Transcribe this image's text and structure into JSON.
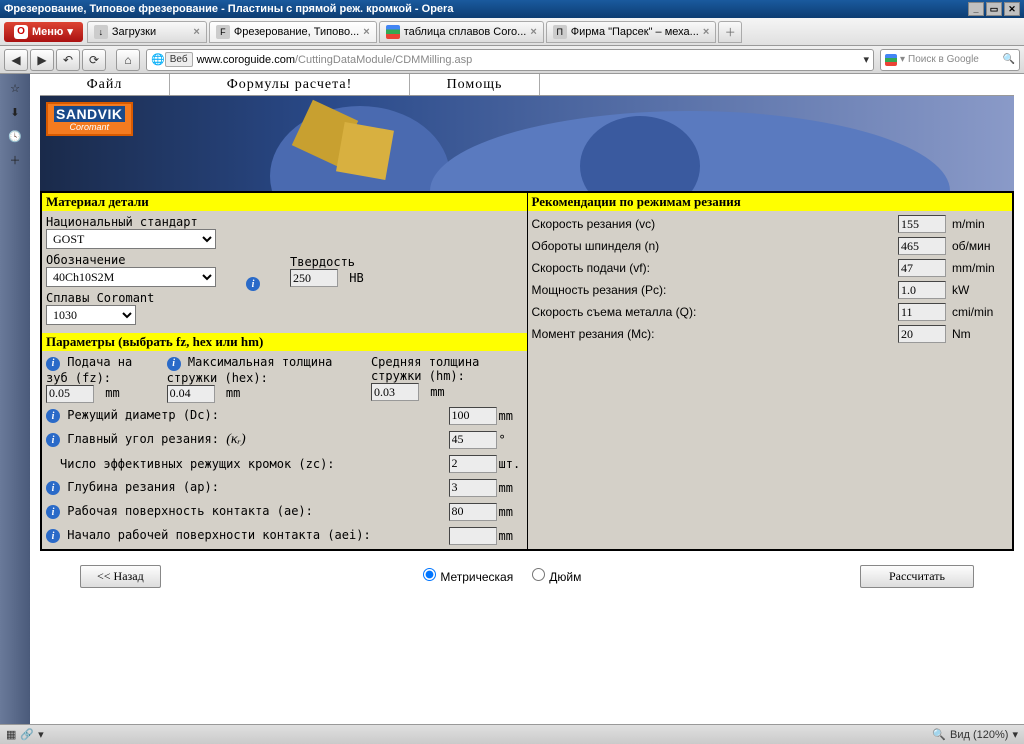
{
  "window": {
    "title": "Фрезерование, Типовое фрезерование - Пластины с прямой реж. кромкой - Opera"
  },
  "opera": {
    "menu": "Меню"
  },
  "tabs": [
    {
      "label": "Загрузки",
      "fav": "↓"
    },
    {
      "label": "Фрезерование, Типово...",
      "fav": "F"
    },
    {
      "label": "таблица сплавов Coro...",
      "fav": "G"
    },
    {
      "label": "Фирма \"Парсек\" – меха...",
      "fav": "П"
    }
  ],
  "url": {
    "web": "Веб",
    "host": "www.coroguide.com",
    "path": "/CuttingDataModule/CDMMilling.asp"
  },
  "search": {
    "placeholder": "Поиск в Google"
  },
  "appmenu": {
    "file": "Файл",
    "formulas": "Формулы расчета!",
    "help": "Помощь"
  },
  "logo": {
    "t1": "SANDVIK",
    "t2": "Coromant"
  },
  "sections": {
    "material": "Материал детали",
    "params": "Параметры (выбрать fz, hex или hm)",
    "recs": "Рекомендации по режимам резания"
  },
  "material": {
    "std_label": "Национальный стандарт",
    "std_value": "GOST",
    "desig_label": "Обозначение",
    "desig_value": "40Ch10S2M",
    "alloy_label": "Сплавы Coromant",
    "alloy_value": "1030",
    "hardness_label": "Твердость",
    "hardness_value": "250",
    "hardness_unit": "HB"
  },
  "params": {
    "fz_label": "Подача на зуб (fz):",
    "fz_value": "0.05",
    "fz_unit": "mm",
    "hex_label": "Максимальная толщина стружки (hex):",
    "hex_value": "0.04",
    "hex_unit": "mm",
    "hm_label": "Средняя толщина стружки (hm):",
    "hm_value": "0.03",
    "hm_unit": "mm",
    "dc_label": "Режущий диаметр (Dc):",
    "dc_value": "100",
    "dc_unit": "mm",
    "kr_label": "Главный угол резания:",
    "kr_sym": "(κᵣ)",
    "kr_value": "45",
    "kr_unit": "°",
    "zc_label": "Число эффективных режущих кромок (zc):",
    "zc_value": "2",
    "zc_unit": "шт.",
    "ap_label": "Глубина резания (ap):",
    "ap_value": "3",
    "ap_unit": "mm",
    "ae_label": "Рабочая поверхность контакта (ae):",
    "ae_value": "80",
    "ae_unit": "mm",
    "aei_label": "Начало рабочей поверхности контакта (aei):",
    "aei_value": "",
    "aei_unit": "mm"
  },
  "recs": {
    "vc_label": "Скорость резания (vc)",
    "vc_value": "155",
    "vc_unit": "m/min",
    "n_label": "Обороты шпинделя (n)",
    "n_value": "465",
    "n_unit": "об/мин",
    "vf_label": "Скорость подачи (vf):",
    "vf_value": "47",
    "vf_unit": "mm/min",
    "pc_label": "Мощность резания (Pc):",
    "pc_value": "1.0",
    "pc_unit": "kW",
    "q_label": "Скорость съема металла (Q):",
    "q_value": "11",
    "q_unit": "cmі/min",
    "mc_label": "Момент резания (Mc):",
    "mc_value": "20",
    "mc_unit": "Nm"
  },
  "controls": {
    "back": "<< Назад",
    "metric": "Метрическая",
    "inch": "Дюйм",
    "calc": "Рассчитать"
  },
  "status": {
    "zoom_label": "Вид (120%)"
  }
}
